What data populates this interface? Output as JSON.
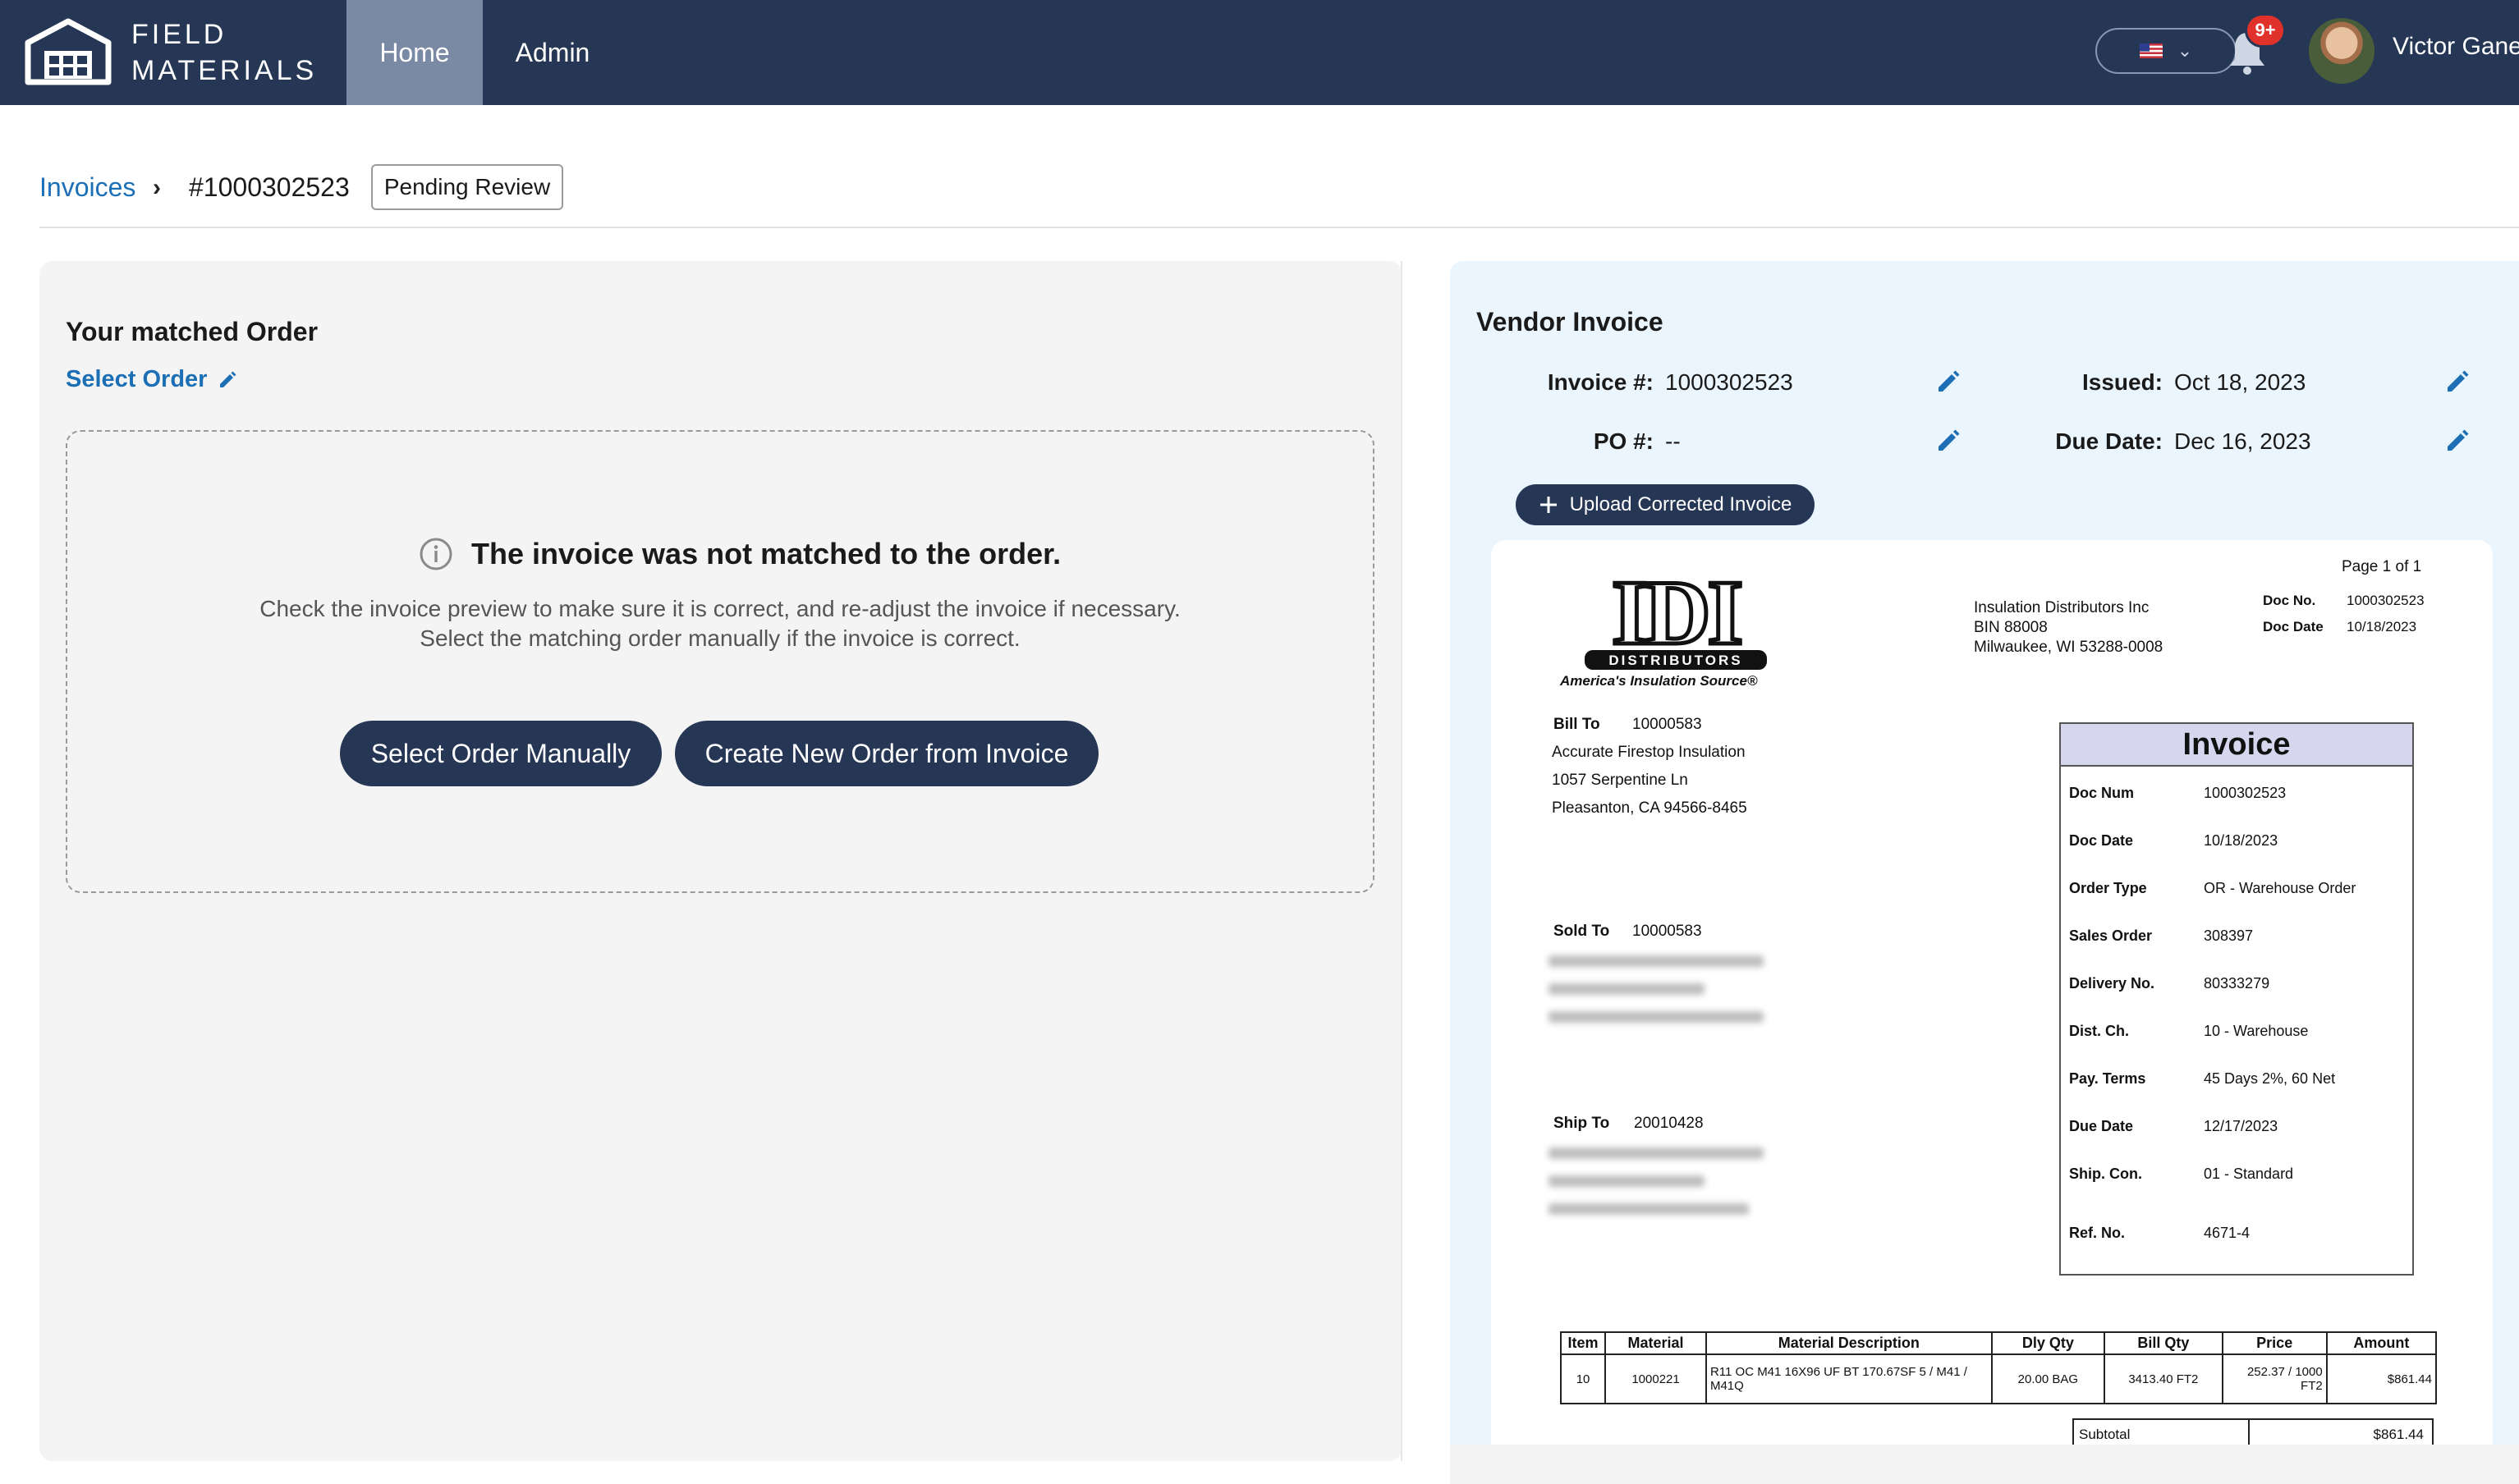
{
  "header": {
    "brand_line1": "FIELD",
    "brand_line2": "MATERIALS",
    "nav": [
      {
        "label": "Home",
        "active": true
      },
      {
        "label": "Admin",
        "active": false
      }
    ],
    "language_icon": "us-flag-icon",
    "notification_badge": "9+",
    "user_name": "Victor Gane",
    "colors": {
      "bar": "#263655",
      "active_tab": "#7a8aa5",
      "badge": "#e0312b"
    }
  },
  "breadcrumb": {
    "parent": "Invoices",
    "current": "#1000302523",
    "status": "Pending Review"
  },
  "left": {
    "title": "Your matched Order",
    "select_link": "Select Order",
    "empty_title": "The invoice was not matched to the order.",
    "empty_line1": "Check the invoice preview to make sure it is correct, and re-adjust the invoice if necessary.",
    "empty_line2": "Select the matching order manually if the invoice is correct.",
    "btn_manual": "Select Order Manually",
    "btn_create": "Create New Order from Invoice"
  },
  "right": {
    "title": "Vendor Invoice",
    "invoice_label": "Invoice #:",
    "invoice_value": "1000302523",
    "issued_label": "Issued:",
    "issued_value": "Oct 18, 2023",
    "po_label": "PO #:",
    "po_value": "--",
    "due_label": "Due Date:",
    "due_value": "Dec 16, 2023",
    "upload_button": "Upload Corrected Invoice",
    "accent": "#1c6fb5"
  },
  "document": {
    "logo_text": "IDI",
    "logo_sub": "DISTRIBUTORS",
    "tagline": "America's Insulation Source®",
    "page": "Page 1 of 1",
    "vendor_name": "Insulation Distributors Inc",
    "vendor_bin": "BIN 88008",
    "vendor_city": "Milwaukee, WI 53288-0008",
    "docno_label": "Doc No.",
    "docno_value": "1000302523",
    "docdate_label": "Doc Date",
    "docdate_value": "10/18/2023",
    "bill_to_label": "Bill To",
    "bill_to_id": "10000583",
    "bill_to_lines": [
      "Accurate Firestop Insulation",
      "1057 Serpentine Ln",
      "Pleasanton, CA 94566-8465"
    ],
    "sold_to_label": "Sold To",
    "sold_to_id": "10000583",
    "ship_to_label": "Ship To",
    "ship_to_id": "20010428",
    "invoice_heading": "Invoice",
    "details": [
      {
        "label": "Doc Num",
        "value": "1000302523"
      },
      {
        "label": "Doc Date",
        "value": "10/18/2023"
      },
      {
        "label": "Order Type",
        "value": "OR - Warehouse Order"
      },
      {
        "label": "Sales Order",
        "value": "308397"
      },
      {
        "label": "Delivery No.",
        "value": "80333279"
      },
      {
        "label": "Dist. Ch.",
        "value": "10 - Warehouse"
      },
      {
        "label": "Pay. Terms",
        "value": "45 Days 2%, 60 Net"
      },
      {
        "label": "Due Date",
        "value": "12/17/2023"
      },
      {
        "label": "Ship. Con.",
        "value": "01 - Standard"
      },
      {
        "label": "Ref. No.",
        "value": "4671-4"
      }
    ],
    "table_headers": [
      "Item",
      "Material",
      "Material Description",
      "Dly Qty",
      "Bill Qty",
      "Price",
      "Amount"
    ],
    "rows": [
      {
        "item": "10",
        "material": "1000221",
        "description": "R11 OC M41 16X96 UF BT 170.67SF 5 / M41 / M41Q",
        "dly_qty": "20.00  BAG",
        "bill_qty": "3413.40  FT2",
        "price": "252.37 / 1000 FT2",
        "amount": "$861.44"
      }
    ],
    "subtotal_label": "Subtotal",
    "subtotal_value": "$861.44"
  }
}
